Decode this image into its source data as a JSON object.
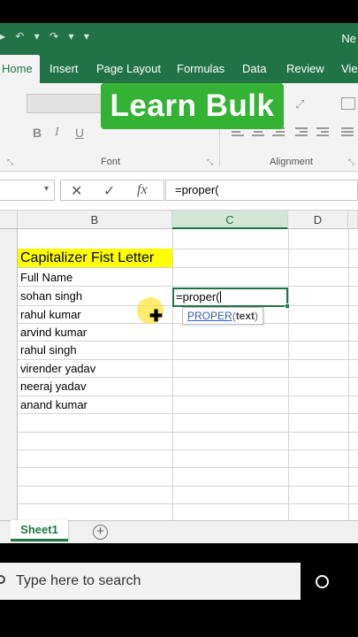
{
  "window": {
    "quick_access": "▸ ↶ ▾ ↷ ▾ ▾",
    "doc_title": "Ne"
  },
  "ribbon": {
    "tabs": [
      {
        "label": "Home",
        "active": true
      },
      {
        "label": "Insert"
      },
      {
        "label": "Page Layout"
      },
      {
        "label": "Formulas"
      },
      {
        "label": "Data"
      },
      {
        "label": "Review"
      },
      {
        "label": "Vie"
      }
    ],
    "font": {
      "bold": "B",
      "italic": "I",
      "underline": "U",
      "group_label": "Font"
    },
    "alignment": {
      "group_label": "Alignment"
    },
    "overlay_text": "Learn Bulk"
  },
  "formula_bar": {
    "name_box": "",
    "cancel_icon": "✕",
    "enter_icon": "✓",
    "fx_label": "fx",
    "formula": "=proper("
  },
  "grid": {
    "columns": [
      "B",
      "C",
      "D"
    ],
    "selected_column": "C",
    "title_cell": "Capitalizer Fist Letter",
    "header_cell": "Full Name",
    "names": [
      "sohan singh",
      "rahul kumar",
      "arvind kumar",
      "rahul singh",
      "virender yadav",
      "neeraj yadav",
      "anand kumar"
    ],
    "active_cell_text": "=proper(",
    "tooltip": {
      "function": "PROPER",
      "open": "(",
      "argument": "text",
      "close": ")"
    }
  },
  "sheets": {
    "tabs": [
      "Sheet1"
    ],
    "add_label": "+"
  },
  "taskbar": {
    "search_placeholder": "Type here to search"
  },
  "colors": {
    "excel_green": "#217346",
    "highlight_yellow": "#ffff00",
    "overlay_green": "#34b233"
  }
}
